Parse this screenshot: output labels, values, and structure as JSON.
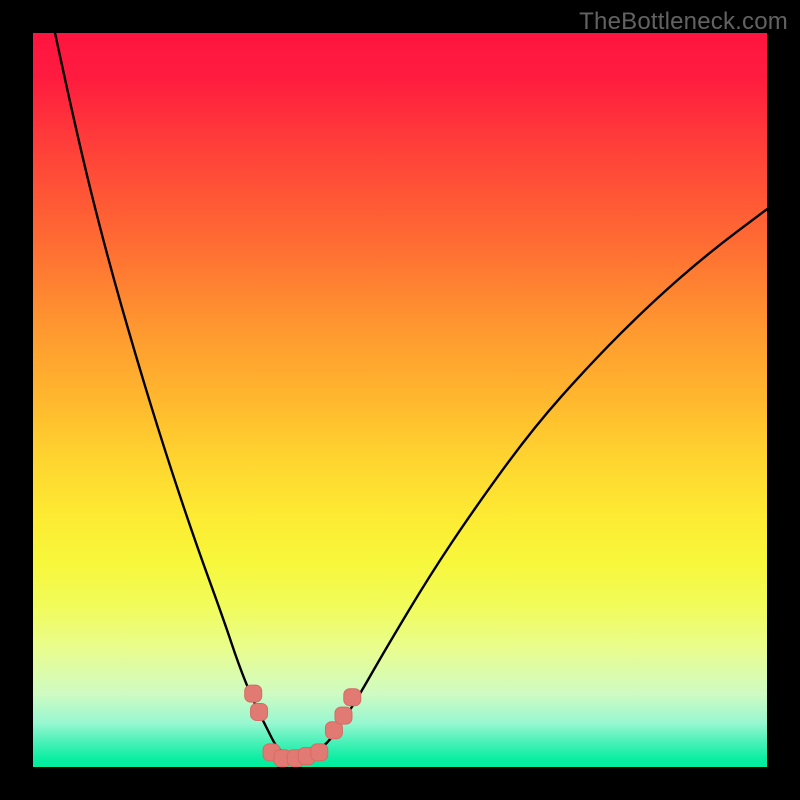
{
  "watermark": "TheBottleneck.com",
  "chart_data": {
    "type": "line",
    "title": "",
    "xlabel": "",
    "ylabel": "",
    "xlim": [
      0,
      100
    ],
    "ylim": [
      0,
      100
    ],
    "grid": false,
    "legend": false,
    "series": [
      {
        "name": "bottleneck-curve",
        "x": [
          3,
          6,
          10,
          14,
          18,
          22,
          26,
          28,
          30,
          32,
          33,
          34,
          35,
          36,
          38,
          40,
          42,
          44,
          48,
          54,
          60,
          68,
          76,
          84,
          92,
          100
        ],
        "y": [
          100,
          86,
          70,
          56,
          43,
          31,
          20,
          14,
          9,
          5,
          3,
          2,
          1,
          1,
          2,
          3,
          6,
          9,
          16,
          26,
          35,
          46,
          55,
          63,
          70,
          76
        ]
      }
    ],
    "markers": [
      {
        "name": "marker-left-upper",
        "x": 30.0,
        "y": 10.0
      },
      {
        "name": "marker-left-lower",
        "x": 30.8,
        "y": 7.5
      },
      {
        "name": "marker-valley-1",
        "x": 32.5,
        "y": 2.0
      },
      {
        "name": "marker-valley-2",
        "x": 34.0,
        "y": 1.2
      },
      {
        "name": "marker-valley-3",
        "x": 35.8,
        "y": 1.2
      },
      {
        "name": "marker-valley-4",
        "x": 37.3,
        "y": 1.5
      },
      {
        "name": "marker-valley-5",
        "x": 39.0,
        "y": 2.0
      },
      {
        "name": "marker-right-lower",
        "x": 41.0,
        "y": 5.0
      },
      {
        "name": "marker-right-mid",
        "x": 42.3,
        "y": 7.0
      },
      {
        "name": "marker-right-upper",
        "x": 43.5,
        "y": 9.5
      }
    ],
    "colors": {
      "curve": "#000000",
      "marker_fill": "#e17a73",
      "marker_stroke": "#d86a63"
    }
  }
}
